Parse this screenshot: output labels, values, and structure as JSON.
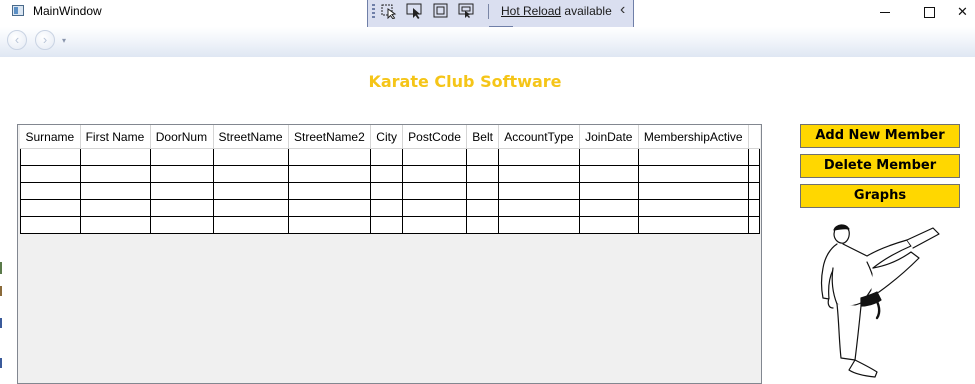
{
  "window": {
    "title": "MainWindow",
    "minimize_glyph": "—",
    "close_glyph": "✕"
  },
  "dev_toolbar": {
    "hot_reload_link": "Hot Reload",
    "hot_reload_status": "available",
    "collapse_glyph": "‹",
    "tools": [
      "select-element-icon",
      "pointer-icon",
      "display-layout-adorners-icon",
      "track-focused-element-icon"
    ]
  },
  "navigation": {
    "back_glyph": "‹",
    "forward_glyph": "›",
    "history_glyph": "▾"
  },
  "heading": "Karate Club Software",
  "table": {
    "columns": [
      "Surname",
      "First Name",
      "DoorNum",
      "StreetName",
      "StreetName2",
      "City",
      "PostCode",
      "Belt",
      "AccountType",
      "JoinDate",
      "MembershipActive"
    ],
    "row_count": 5
  },
  "buttons": {
    "add": "Add New Member",
    "delete": "Delete Member",
    "graphs": "Graphs"
  },
  "colors": {
    "accent": "#ffd700",
    "heading": "#f5c518",
    "grid_background": "#f0f0f0"
  }
}
